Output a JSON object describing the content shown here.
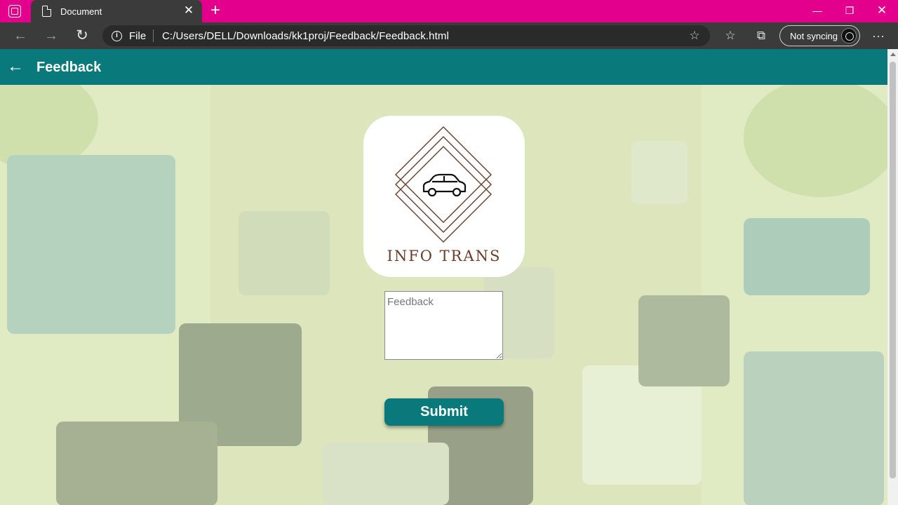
{
  "browser": {
    "tab_title": "Document",
    "address_scheme": "File",
    "url": "C:/Users/DELL/Downloads/kk1proj/Feedback/Feedback.html",
    "sync_label": "Not syncing"
  },
  "app": {
    "title": "Feedback",
    "logo_text": "INFO TRANS",
    "feedback_placeholder": "Feedback",
    "submit_label": "Submit"
  },
  "colors": {
    "browser_accent": "#e3008c",
    "app_bar": "#09797b",
    "logo_brown": "#6b3d26"
  }
}
